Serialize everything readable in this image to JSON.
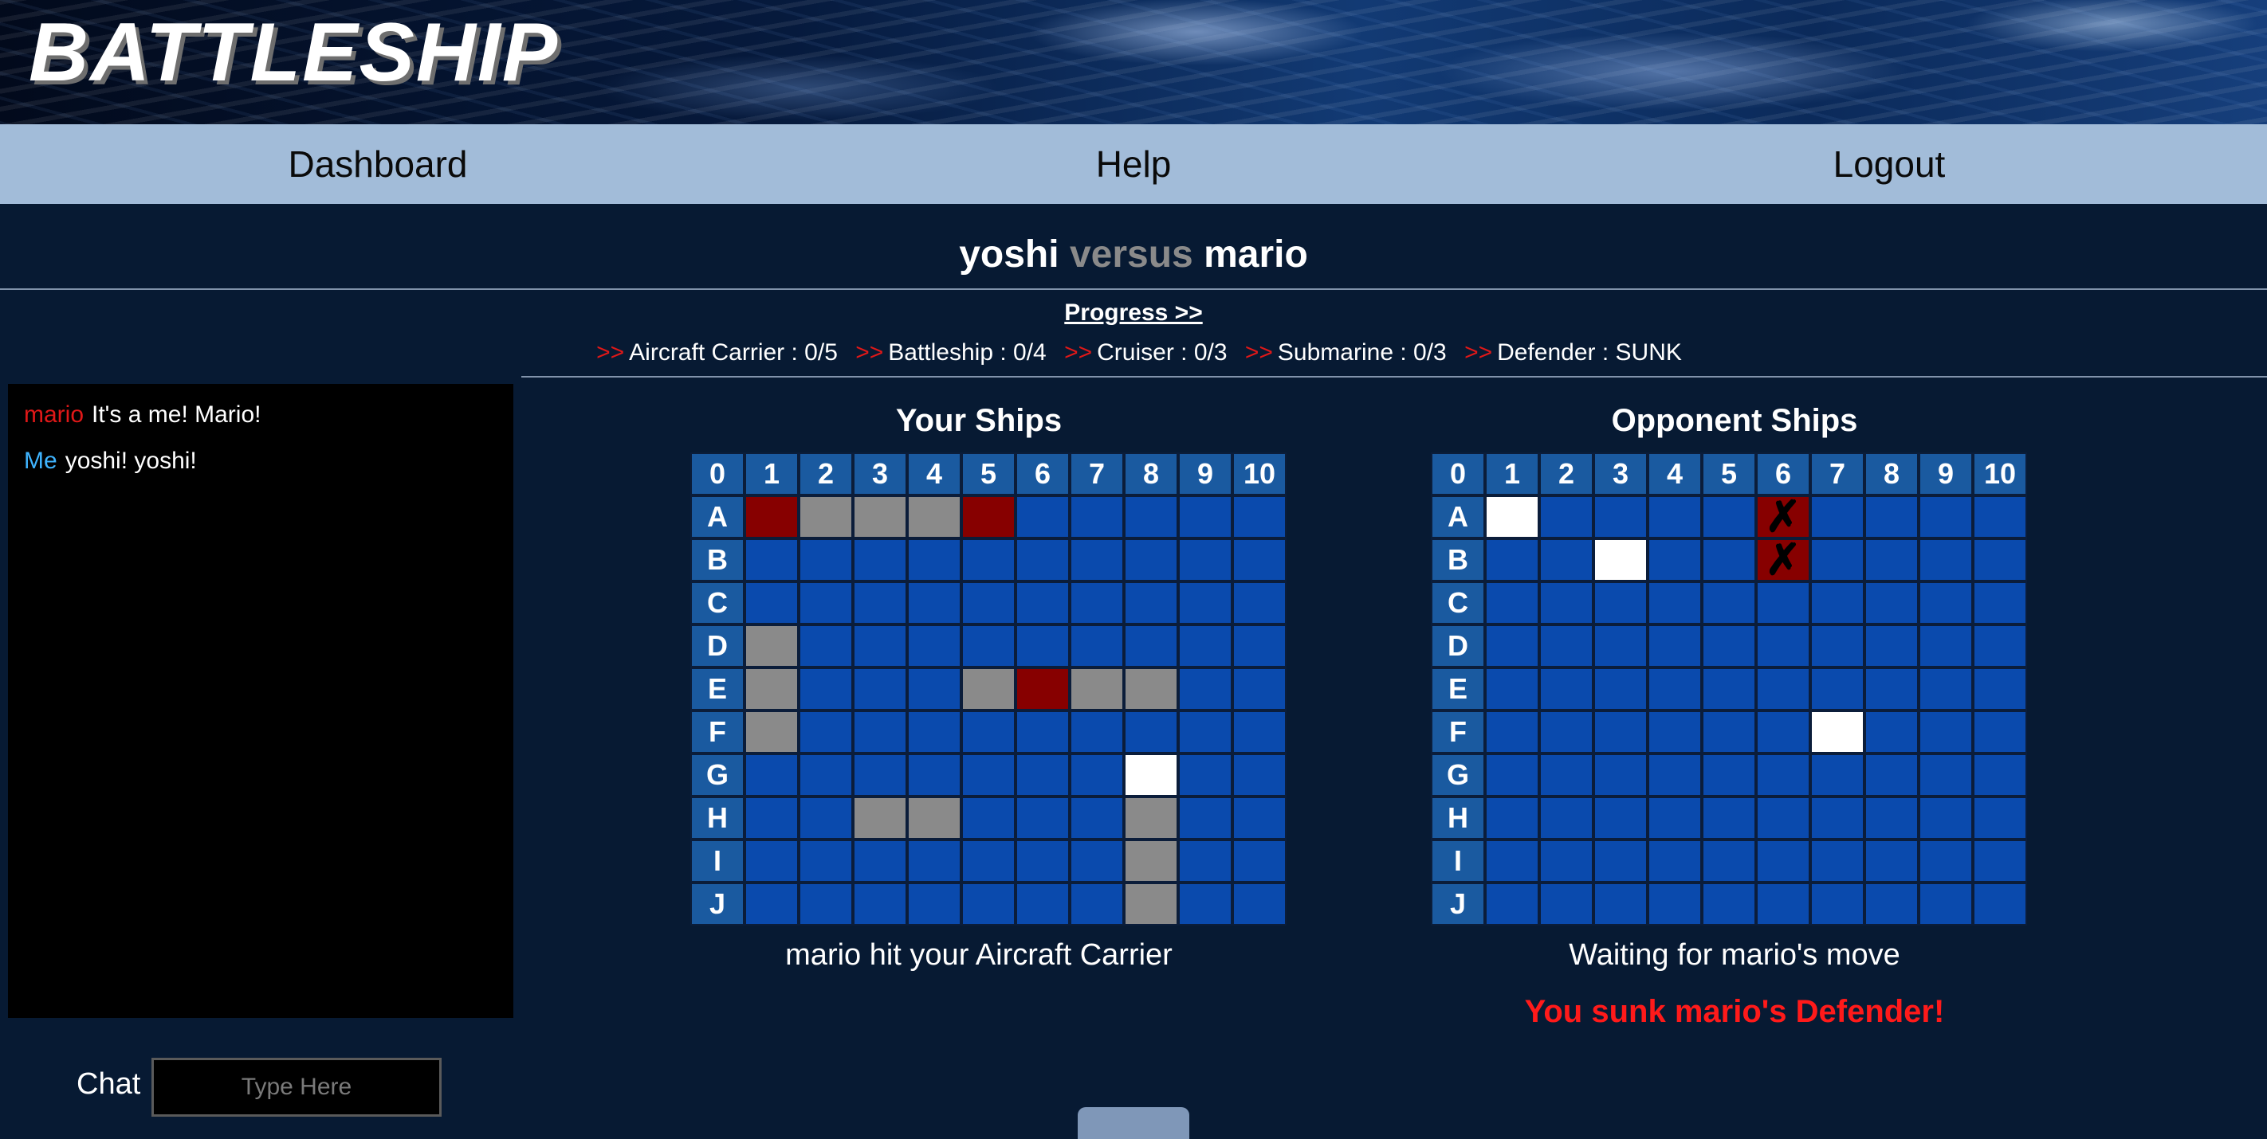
{
  "header": {
    "logo": "BATTLESHIP"
  },
  "nav": {
    "dashboard": "Dashboard",
    "help": "Help",
    "logout": "Logout"
  },
  "match": {
    "player": "yoshi",
    "versus": "versus",
    "opponent": "mario"
  },
  "progress": {
    "link": "Progress >>",
    "arrows": ">>",
    "items": [
      "Aircraft Carrier : 0/5",
      "Battleship : 0/4",
      "Cruiser : 0/3",
      "Submarine : 0/3",
      "Defender : SUNK"
    ]
  },
  "chat": {
    "messages": [
      {
        "from": "mario",
        "text": "It's a me! Mario!"
      },
      {
        "from": "Me",
        "text": "yoshi! yoshi!"
      }
    ],
    "label": "Chat",
    "placeholder": "Type Here"
  },
  "boards": {
    "column_headers": [
      "0",
      "1",
      "2",
      "3",
      "4",
      "5",
      "6",
      "7",
      "8",
      "9",
      "10"
    ],
    "row_headers": [
      "A",
      "B",
      "C",
      "D",
      "E",
      "F",
      "G",
      "H",
      "I",
      "J"
    ],
    "cell_key": {
      ".": "water",
      "S": "ship",
      "H": "hit",
      "M": "miss",
      "X": "sunk"
    },
    "sunk_mark": "✗",
    "yours": {
      "title": "Your Ships",
      "status": "mario hit your Aircraft Carrier",
      "rows": [
        "HSSSH.....",
        "..........",
        "..........",
        "S.........",
        "S...SHSS..",
        "S.........",
        ".......M..",
        "..SS...S..",
        ".......S..",
        ".......S.."
      ]
    },
    "opponent": {
      "title": "Opponent Ships",
      "status": "Waiting for mario's move",
      "alert": "You sunk mario's Defender!",
      "rows": [
        "M....X....",
        "..M..X....",
        "..........",
        "..........",
        "..........",
        "......M...",
        "..........",
        "..........",
        "..........",
        ".........."
      ]
    }
  },
  "colors": {
    "background": "#071a33",
    "nav": "#a2bcd9",
    "water": "#0a4aad",
    "ship": "#8a8a8a",
    "hit": "#870000",
    "miss": "#ffffff",
    "alert": "#ff1a1a",
    "chat_me": "#3fb4ff",
    "chat_opponent": "#e01818"
  }
}
